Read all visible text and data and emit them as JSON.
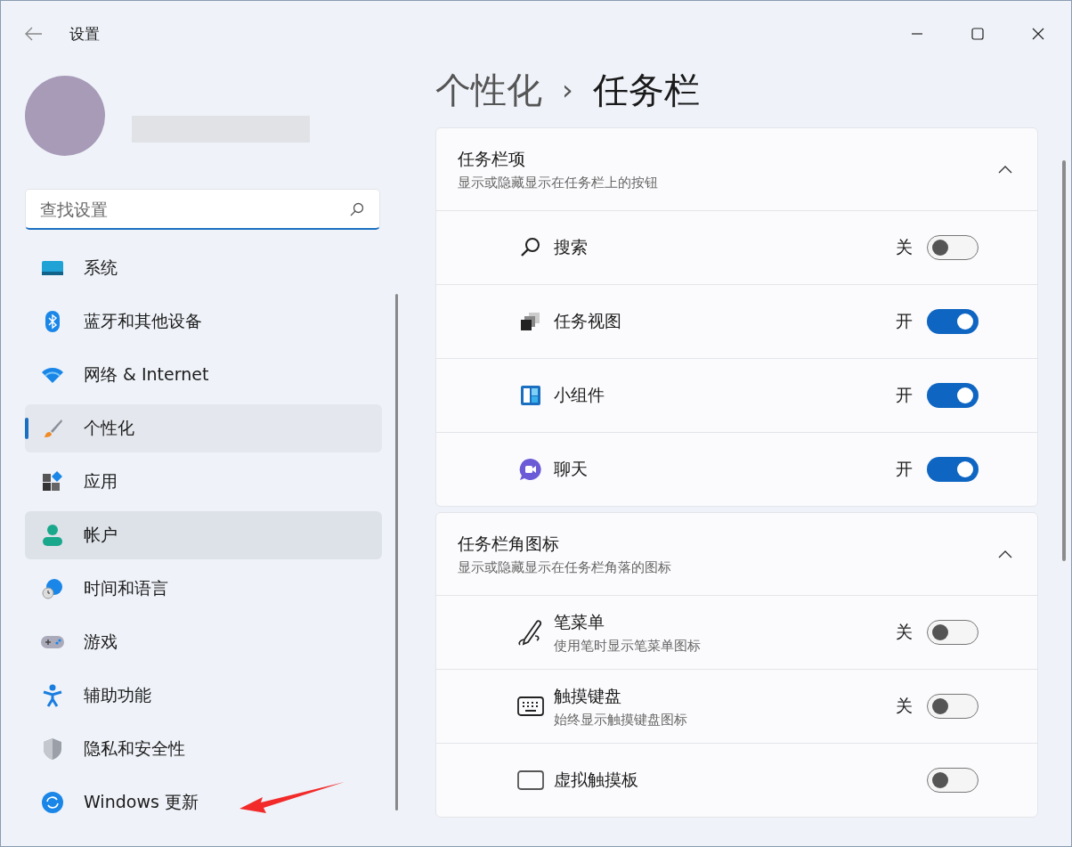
{
  "window": {
    "title": "设置"
  },
  "search": {
    "placeholder": "查找设置"
  },
  "sidebar": {
    "items": [
      {
        "label": "系统",
        "kind": "system",
        "selected": false,
        "hovered": false
      },
      {
        "label": "蓝牙和其他设备",
        "kind": "bluetooth",
        "selected": false,
        "hovered": false
      },
      {
        "label": "网络 & Internet",
        "kind": "network",
        "selected": false,
        "hovered": false
      },
      {
        "label": "个性化",
        "kind": "brush",
        "selected": true,
        "hovered": false
      },
      {
        "label": "应用",
        "kind": "apps",
        "selected": false,
        "hovered": false
      },
      {
        "label": "帐户",
        "kind": "account",
        "selected": false,
        "hovered": true
      },
      {
        "label": "时间和语言",
        "kind": "time",
        "selected": false,
        "hovered": false
      },
      {
        "label": "游戏",
        "kind": "game",
        "selected": false,
        "hovered": false
      },
      {
        "label": "辅助功能",
        "kind": "access",
        "selected": false,
        "hovered": false
      },
      {
        "label": "隐私和安全性",
        "kind": "privacy",
        "selected": false,
        "hovered": false
      },
      {
        "label": "Windows 更新",
        "kind": "update",
        "selected": false,
        "hovered": false
      }
    ]
  },
  "breadcrumb": {
    "parent": "个性化",
    "separator": "›",
    "current": "任务栏"
  },
  "sections": [
    {
      "title": "任务栏项",
      "subtitle": "显示或隐藏显示在任务栏上的按钮",
      "expanded": true,
      "rows": [
        {
          "label": "搜索",
          "kind": "search",
          "state_label": "关",
          "on": false
        },
        {
          "label": "任务视图",
          "kind": "taskview",
          "state_label": "开",
          "on": true
        },
        {
          "label": "小组件",
          "kind": "widgets",
          "state_label": "开",
          "on": true
        },
        {
          "label": "聊天",
          "kind": "chat",
          "state_label": "开",
          "on": true
        }
      ]
    },
    {
      "title": "任务栏角图标",
      "subtitle": "显示或隐藏显示在任务栏角落的图标",
      "expanded": true,
      "rows": [
        {
          "label": "笔菜单",
          "description": "使用笔时显示笔菜单图标",
          "kind": "pen",
          "state_label": "关",
          "on": false
        },
        {
          "label": "触摸键盘",
          "description": "始终显示触摸键盘图标",
          "kind": "keyboard",
          "state_label": "关",
          "on": false
        },
        {
          "label": "虚拟触摸板",
          "kind": "touchpad",
          "on": false
        }
      ]
    }
  ]
}
